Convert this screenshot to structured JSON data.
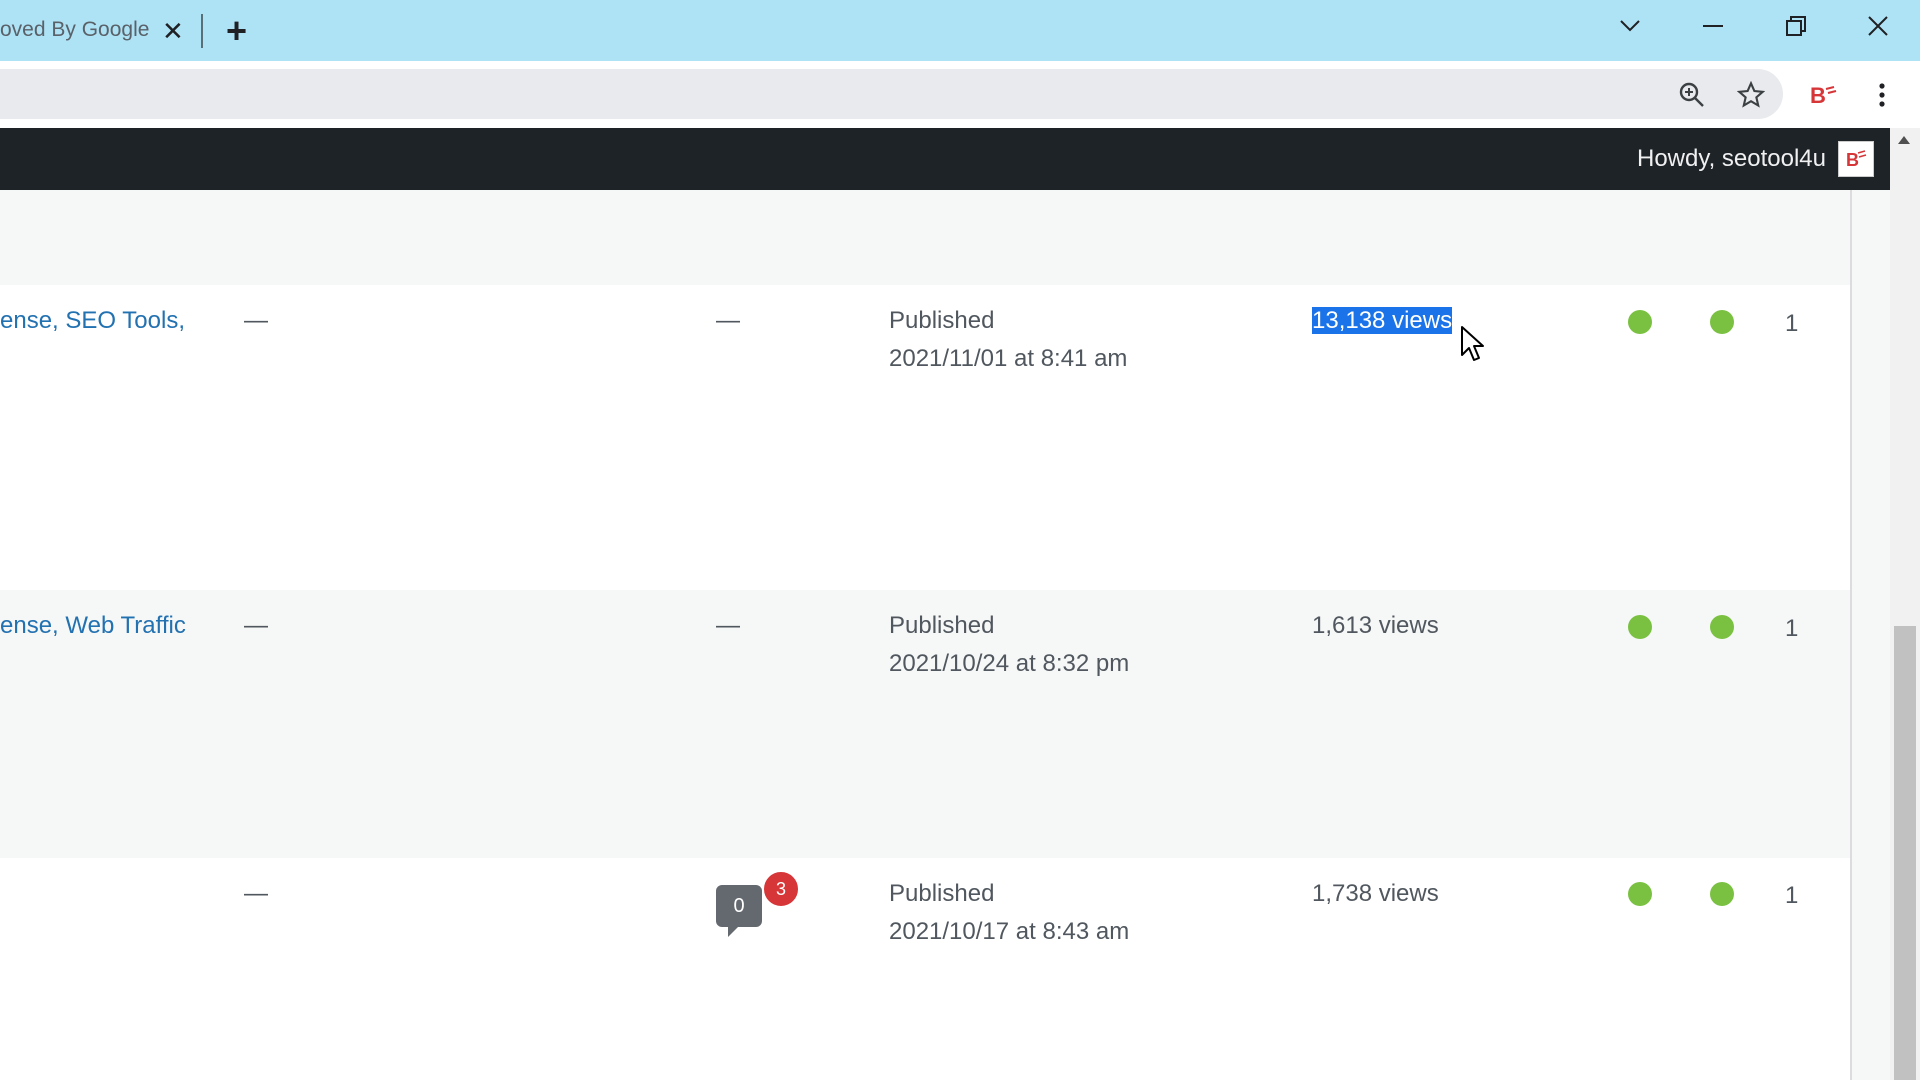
{
  "browser": {
    "tab_title": "oved By Google",
    "tab_close": "✕",
    "new_tab": "+",
    "window_controls": {
      "dropdown": "chevron-down-icon",
      "minimize": "minimize-icon",
      "restore": "restore-icon",
      "close": "close-icon"
    },
    "toolbar_icons": [
      "zoom-icon",
      "star-icon",
      "extension-icon",
      "menu-icon"
    ]
  },
  "adminbar": {
    "greeting": "Howdy, seotool4u"
  },
  "rows": [
    {
      "categories": "ense, SEO Tools,",
      "tags": "—",
      "comments": "—",
      "status": "Published",
      "date": "2021/11/01 at 8:41 am",
      "views": "13,138 views",
      "views_selected": true,
      "count": "1"
    },
    {
      "categories": "ense, Web Traffic",
      "tags": "—",
      "comments": "—",
      "status": "Published",
      "date": "2021/10/24 at 8:32 pm",
      "views": "1,613 views",
      "count": "1"
    },
    {
      "categories": "",
      "tags": "—",
      "comments_count": "0",
      "pending_comments": "3",
      "status": "Published",
      "date": "2021/10/17 at 8:43 am",
      "views": "1,738 views",
      "count": "1"
    }
  ],
  "colors": {
    "tabstrip": "#aee3f6",
    "adminbar": "#1d2327",
    "link": "#2271b1",
    "seo_dot": "#7ac142",
    "selection": "#1a73e8",
    "badge": "#d63638"
  }
}
